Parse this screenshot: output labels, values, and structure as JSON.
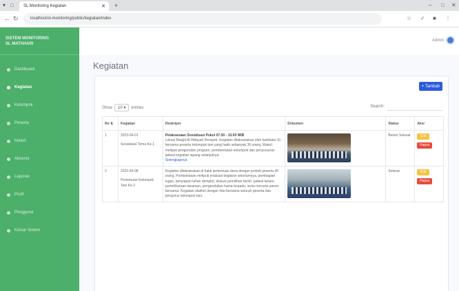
{
  "browser": {
    "tab_title": "SL Monitoring Kegiatan",
    "url": "localhost/sl-monitoring/public/kegiatan/index"
  },
  "sidebar": {
    "brand_line1": "SISTEM MONITORING",
    "brand_line2": "SL MATAHARI",
    "items": [
      {
        "label": "Dashboard",
        "active": false
      },
      {
        "label": "Kegiatan",
        "active": true
      },
      {
        "label": "Kelompok",
        "active": false
      },
      {
        "label": "Peserta",
        "active": false
      },
      {
        "label": "Materi",
        "active": false
      },
      {
        "label": "Absensi",
        "active": false
      },
      {
        "label": "Laporan",
        "active": false
      },
      {
        "label": "Profil",
        "active": false
      },
      {
        "label": "Pengguna",
        "active": false
      },
      {
        "label": "Keluar Sistem",
        "active": false
      }
    ]
  },
  "topbar": {
    "user_name": "Admin"
  },
  "page": {
    "title": "Kegiatan"
  },
  "card": {
    "add_label": "+ Tambah",
    "show_label": "Show",
    "entries_value": "10",
    "entries_label": "entries",
    "search_label": "Search:",
    "search_value": ""
  },
  "table": {
    "headers": [
      "No",
      "Kegiatan",
      "Deskripsi",
      "Dokumen",
      "Status",
      "Aksi"
    ],
    "rows": [
      {
        "no": "1",
        "tanggal": "2023-04-01",
        "kegiatan": "Sosialisasi Tema Ke-1",
        "deskripsi_title": "Pelaksanaan Sosialisasi Pukul 07.00 - 10.00 WIB",
        "deskripsi": "Lokasi Masjid Al Hidayah Rempek. Kegiatan dilaksanakan oleh fasilitator SL bersama peserta kelompok tani yang hadir sebanyak 35 orang. Materi meliputi pengenalan program, pembentukan kelompok dan penyusunan jadwal kegiatan lapang selanjutnya.",
        "deskripsi_more": "Selengkapnya",
        "status": "Belum Selesai",
        "edit_label": "Edit",
        "delete_label": "Hapus"
      },
      {
        "no": "2",
        "tanggal": "2023-04-08",
        "kegiatan": "Pertemuan Kelompok Tani Ke-2",
        "deskripsi_title": "",
        "deskripsi": "Kegiatan dilaksanakan di balai pertemuan desa dengan jumlah peserta 40 orang. Pembahasan meliputi evaluasi kegiatan sebelumnya, pembagian tugas, penyiapan lahan demplot, diskusi pemilihan benih, jadwal tanam, pemeliharaan tanaman, pengendalian hama terpadu, serta rencana panen bersama. Kegiatan diakhiri dengan foto bersama seluruh peserta dan pengurus kelompok tani.",
        "deskripsi_more": "",
        "status": "Selesai",
        "edit_label": "Edit",
        "delete_label": "Hapus"
      }
    ]
  }
}
